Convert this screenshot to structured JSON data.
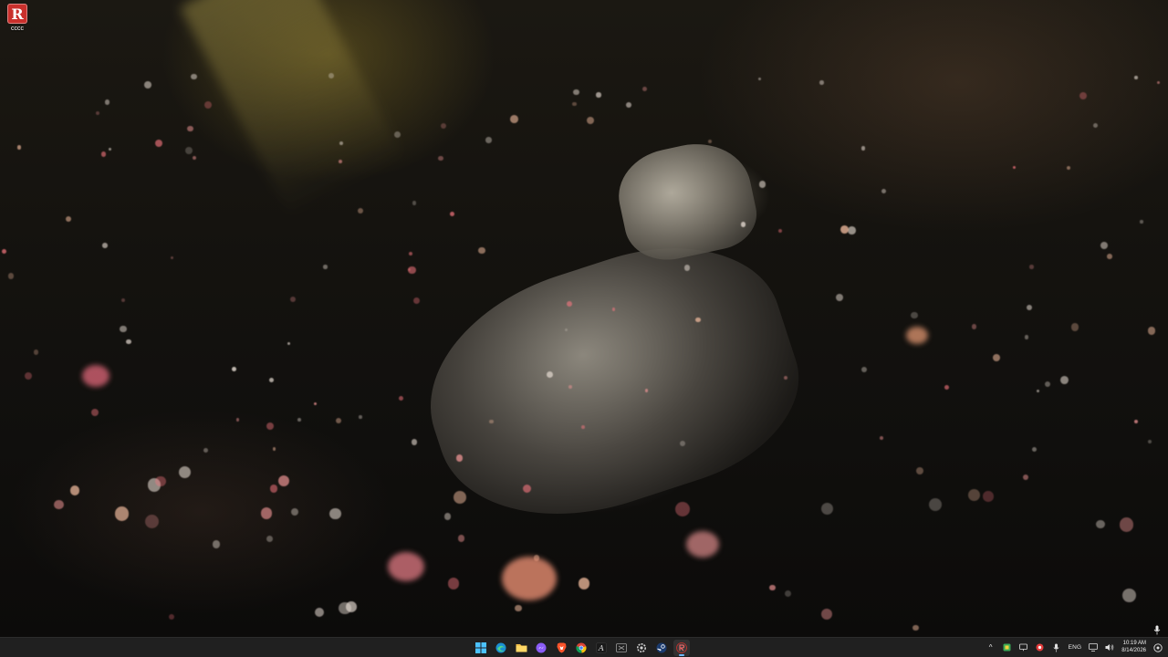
{
  "desktop": {
    "icons": [
      {
        "label": "cccc",
        "glyph": "R",
        "color": "#c9302c"
      }
    ]
  },
  "taskbar": {
    "apps": [
      {
        "name": "start",
        "icon": "windows-icon"
      },
      {
        "name": "edge",
        "icon": "edge-icon"
      },
      {
        "name": "file-explorer",
        "icon": "folder-icon"
      },
      {
        "name": "messenger",
        "icon": "messenger-icon"
      },
      {
        "name": "brave",
        "icon": "brave-icon"
      },
      {
        "name": "chrome",
        "icon": "chrome-icon"
      },
      {
        "name": "terminal-app",
        "icon": "terminal-a-icon",
        "glyph": "A"
      },
      {
        "name": "capture",
        "icon": "capture-icon"
      },
      {
        "name": "settings-app",
        "icon": "gear-app-icon"
      },
      {
        "name": "steam",
        "icon": "steam-icon"
      },
      {
        "name": "active-app",
        "icon": "red-r-icon",
        "active": true
      }
    ],
    "tray": {
      "chevron": "^",
      "language": "ENG",
      "time": "10:19 AM",
      "date": "8/14/2026"
    }
  },
  "colors": {
    "taskbar_bg": "#202020",
    "accent": "#6fb8ff"
  }
}
